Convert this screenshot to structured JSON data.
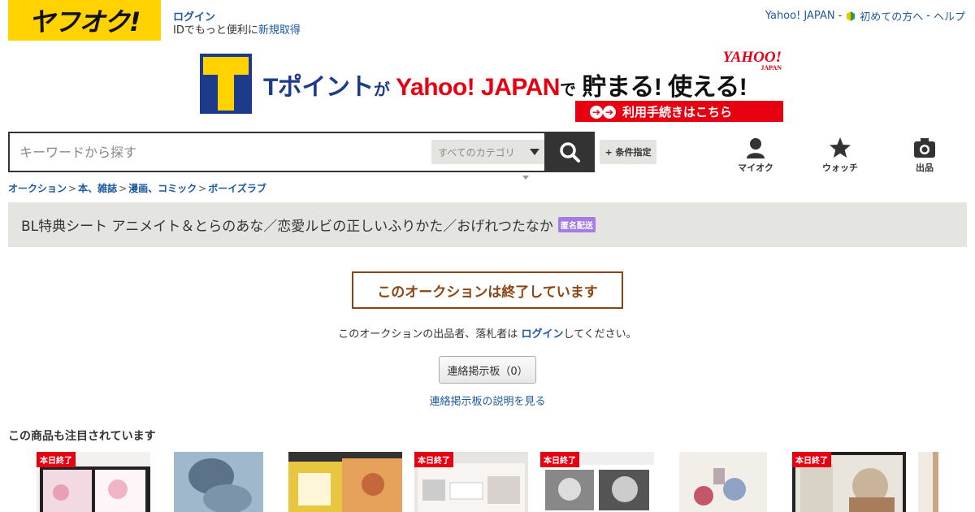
{
  "header": {
    "logo_text": "ヤフオク!",
    "login_label": "ログイン",
    "login_sub_text": "IDでもっと便利に",
    "register_label": "新規取得",
    "top_links": {
      "yahoo_japan": "Yahoo! JAPAN",
      "sep1": "-",
      "first_time": "初めての方へ",
      "sep2": "-",
      "help": "ヘルプ"
    }
  },
  "banner": {
    "t_point": "Tポイント",
    "ga": "が",
    "yahoo_japan": "Yahoo! JAPAN",
    "de": "で",
    "tamaru": "貯まる! 使える!",
    "logo_main": "YAHOO!",
    "logo_sub": "JAPAN",
    "cta": "利用手続きはこちら"
  },
  "search": {
    "placeholder": "キーワードから探す",
    "category_label": "すべてのカテゴリ",
    "condition_label": "+ 条件指定"
  },
  "nav_icons": [
    {
      "label": "マイオク",
      "icon": "person-icon"
    },
    {
      "label": "ウォッチ",
      "icon": "star-icon"
    },
    {
      "label": "出品",
      "icon": "camera-icon"
    }
  ],
  "breadcrumb": [
    {
      "label": "オークション"
    },
    {
      "label": "本、雑誌"
    },
    {
      "label": "漫画、コミック"
    },
    {
      "label": "ボーイズラブ"
    }
  ],
  "breadcrumb_sep": ">",
  "item": {
    "title": "BL特典シート アニメイト＆とらのあな／恋愛ルビの正しいふりかた／おげれつたなか",
    "badge": "匿名配送"
  },
  "auction_status": {
    "ended_text": "このオークションは終了しています",
    "message_before": "このオークションの出品者、落札者は ",
    "message_link": "ログイン",
    "message_after": "してください。",
    "board_button": "連絡掲示板（0）",
    "board_help": "連絡掲示板の説明を見る"
  },
  "recommended": {
    "heading": "この商品も注目されています",
    "items": [
      {
        "badge": "本日終了"
      },
      {
        "badge": ""
      },
      {
        "badge": ""
      },
      {
        "badge": "本日終了"
      },
      {
        "badge": "本日終了"
      },
      {
        "badge": ""
      },
      {
        "badge": "本日終了"
      },
      {
        "badge": ""
      }
    ]
  },
  "colors": {
    "logo_bg": "#ffd200",
    "link": "#1d5aa0",
    "ended": "#8b4513",
    "badge_red": "#e60012",
    "anon_badge": "#a57be6"
  }
}
